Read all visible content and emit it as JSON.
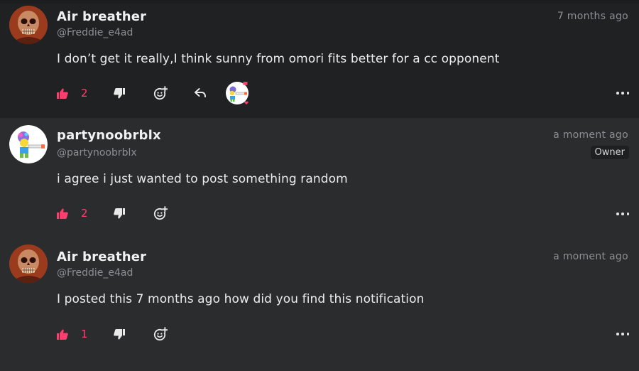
{
  "comments": [
    {
      "author": "Air breather",
      "handle": "@Freddie_e4ad",
      "time": "7 months ago",
      "text": "I don’t get it really,I think sunny from omori fits better for a cc opponent",
      "likes": "2",
      "avatar": "skull-avatar"
    },
    {
      "author": "partynoobrblx",
      "handle": "@partynoobrblx",
      "time": "a moment ago",
      "badge": "Owner",
      "text": "i agree i just wanted to post something random",
      "likes": "2",
      "avatar": "noob-avatar"
    },
    {
      "author": "Air breather",
      "handle": "@Freddie_e4ad",
      "time": "a moment ago",
      "text": "I posted this 7 months ago how did you find this notification",
      "likes": "1",
      "avatar": "skull-avatar"
    }
  ],
  "colors": {
    "accent": "#ff3d6e",
    "background": "#2b2c2e",
    "highlighted_background": "#202123",
    "muted_text": "#8d8e91"
  },
  "icons": [
    "thumbs-up-icon",
    "thumbs-down-icon",
    "add-reaction-icon",
    "reply-icon",
    "more-icon"
  ]
}
